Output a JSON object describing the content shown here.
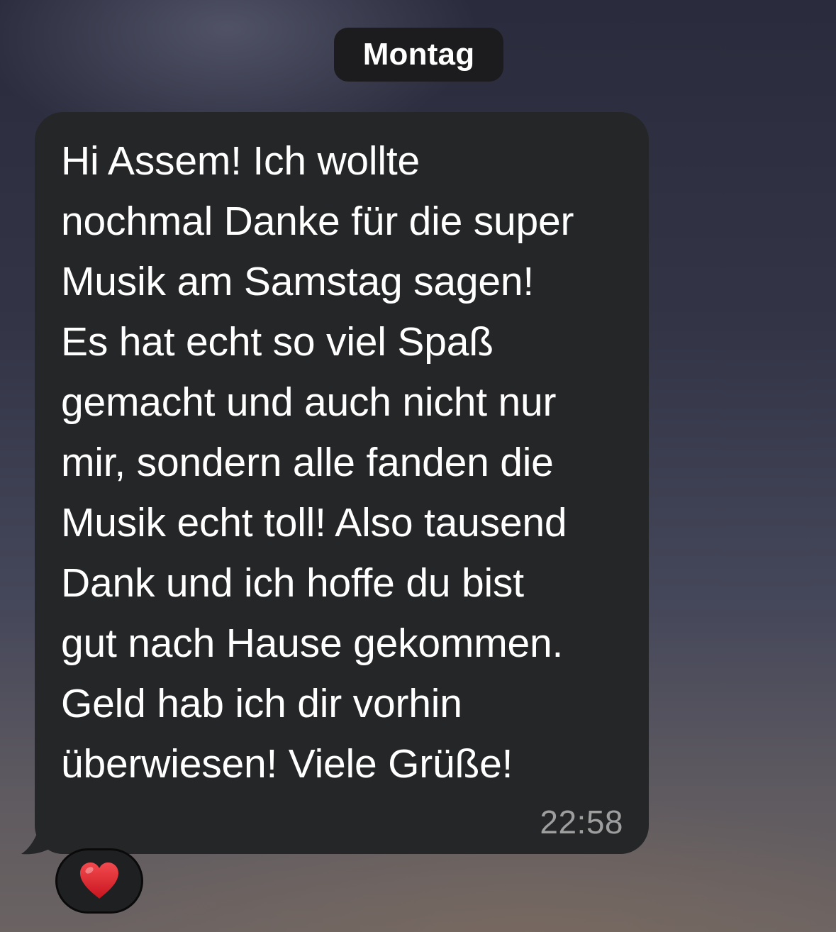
{
  "date_separator": "Montag",
  "message": {
    "text": "Hi Assem! Ich wollte\nnochmal Danke für die super\nMusik am Samstag sagen!\nEs hat echt so viel Spaß\ngemacht und auch nicht nur\nmir, sondern alle fanden die\nMusik echt toll! Also tausend\nDank und ich hoffe du bist\ngut nach Hause gekommen.\nGeld hab ich dir vorhin\nüberwiesen! Viele Grüße!",
    "time": "22:58",
    "bubble_color": "#252627"
  },
  "reaction": {
    "icon": "red-heart-icon",
    "color": "#e0202a"
  }
}
